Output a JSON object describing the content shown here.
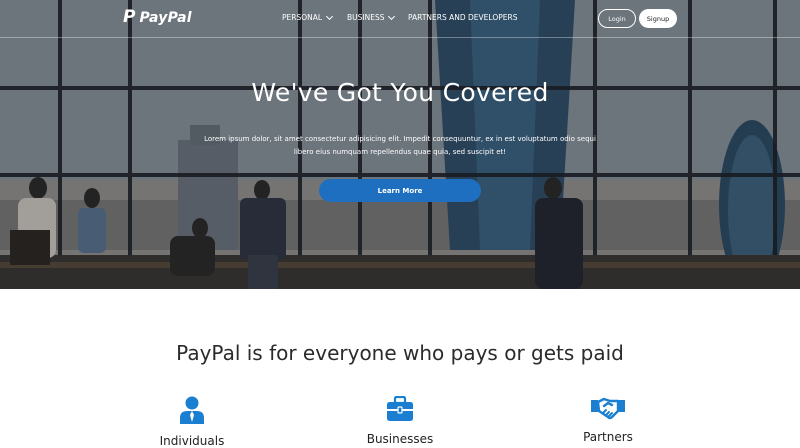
{
  "header": {
    "brand": "PayPal",
    "brand_mark": "P",
    "nav": [
      {
        "label": "PERSONAL",
        "has_dropdown": true
      },
      {
        "label": "BUSINESS",
        "has_dropdown": true
      },
      {
        "label": "PARTNERS AND DEVELOPERS",
        "has_dropdown": false
      }
    ],
    "login_label": "Login",
    "signup_label": "Signup"
  },
  "hero": {
    "title": "We've Got You Covered",
    "text_line1": "Lorem ipsum dolor, sit amet consectetur adipisicing elit. Impedit consequuntur, ex in est voluptatum odio sequi",
    "text_line2": "libero eius numquam repellendus quae quia, sed suscipit et!",
    "cta_label": "Learn More"
  },
  "features": {
    "title": "PayPal is for everyone who pays or gets paid",
    "items": [
      {
        "label": "Individuals",
        "icon": "user-icon"
      },
      {
        "label": "Businesses",
        "icon": "briefcase-icon"
      },
      {
        "label": "Partners",
        "icon": "handshake-icon"
      }
    ]
  },
  "colors": {
    "accent": "#1e6fbf",
    "icon_blue": "#1a7fd0",
    "text_dark": "#2b2b2b"
  }
}
